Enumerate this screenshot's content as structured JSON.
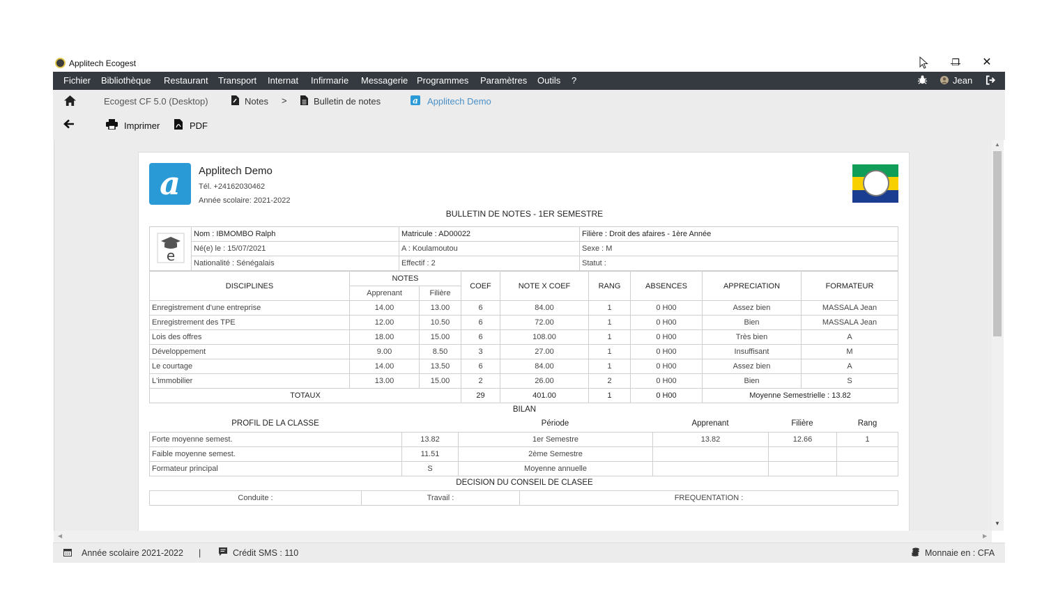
{
  "window": {
    "title": "Applitech Ecogest"
  },
  "menu": {
    "items": [
      "Fichier",
      "Bibliothèque",
      "Restaurant",
      "Transport",
      "Internat",
      "Infirmarie",
      "Messagerie",
      "Programmes",
      "Paramètres",
      "Outils",
      "?"
    ],
    "user": "Jean"
  },
  "breadcrumb": {
    "app": "Ecogest CF 5.0 (Desktop)",
    "notes": "Notes",
    "separator": ">",
    "bulletin": "Bulletin de notes",
    "school": "Applitech Demo"
  },
  "toolbar": {
    "print": "Imprimer",
    "pdf": "PDF"
  },
  "school": {
    "name": "Applitech Demo",
    "phone": "Tél. +24162030462",
    "year": "Année scolaire: 2021-2022",
    "logo_letter": "a"
  },
  "report_title": "BULLETIN DE NOTES - 1ER SEMESTRE",
  "student": {
    "nom": "Nom : IBMOMBO Ralph",
    "matricule": "Matricule : AD00022",
    "filiere": "Filière : Droit des afaires - 1ère Année",
    "naissance": "Né(e) le : 15/07/2021",
    "lieu": "A : Koulamoutou",
    "sexe": "Sexe : M",
    "nationalite": "Nationalité : Sénégalais",
    "effectif": "Effectif : 2",
    "statut": "Statut :"
  },
  "grades": {
    "headers": {
      "disciplines": "DISCIPLINES",
      "notes": "NOTES",
      "apprenant": "Apprenant",
      "filiere": "Filière",
      "coef": "COEF",
      "note_x_coef": "NOTE X COEF",
      "rang": "RANG",
      "absences": "ABSENCES",
      "appreciation": "APPRECIATION",
      "formateur": "FORMATEUR"
    },
    "rows": [
      {
        "discipline": "Enregistrement d'une entreprise",
        "apprenant": "14.00",
        "filiere": "13.00",
        "coef": "6",
        "note_x_coef": "84.00",
        "rang": "1",
        "absences": "0 H00",
        "appreciation": "Assez bien",
        "formateur": "MASSALA Jean"
      },
      {
        "discipline": "Enregistrement des TPE",
        "apprenant": "12.00",
        "filiere": "10.50",
        "coef": "6",
        "note_x_coef": "72.00",
        "rang": "1",
        "absences": "0 H00",
        "appreciation": "Bien",
        "formateur": "MASSALA Jean"
      },
      {
        "discipline": "Lois des offres",
        "apprenant": "18.00",
        "filiere": "15.00",
        "coef": "6",
        "note_x_coef": "108.00",
        "rang": "1",
        "absences": "0 H00",
        "appreciation": "Très bien",
        "formateur": "A"
      },
      {
        "discipline": "Développement",
        "apprenant": "9.00",
        "filiere": "8.50",
        "coef": "3",
        "note_x_coef": "27.00",
        "rang": "1",
        "absences": "0 H00",
        "appreciation": "Insuffisant",
        "formateur": "M"
      },
      {
        "discipline": "Le courtage",
        "apprenant": "14.00",
        "filiere": "13.50",
        "coef": "6",
        "note_x_coef": "84.00",
        "rang": "1",
        "absences": "0 H00",
        "appreciation": "Assez bien",
        "formateur": "A"
      },
      {
        "discipline": "L'immobilier",
        "apprenant": "13.00",
        "filiere": "15.00",
        "coef": "2",
        "note_x_coef": "26.00",
        "rang": "2",
        "absences": "0 H00",
        "appreciation": "Bien",
        "formateur": "S"
      }
    ],
    "totals": {
      "label": "TOTAUX",
      "coef": "29",
      "note_x_coef": "401.00",
      "rang": "1",
      "absences": "0 H00",
      "moyenne": "Moyenne Semestrielle : 13.82"
    }
  },
  "bilan": {
    "title": "BILAN",
    "profil_title": "PROFIL DE LA CLASSE",
    "periode_h": "Période",
    "apprenant_h": "Apprenant",
    "filiere_h": "Filière",
    "rang_h": "Rang",
    "rows": [
      {
        "label": "Forte moyenne semest.",
        "value": "13.82",
        "periode": "1er Semestre",
        "apprenant": "13.82",
        "filiere": "12.66",
        "rang": "1"
      },
      {
        "label": "Faible moyenne semest.",
        "value": "11.51",
        "periode": "2ème Semestre",
        "apprenant": "",
        "filiere": "",
        "rang": ""
      },
      {
        "label": "Formateur principal",
        "value": "S",
        "periode": "Moyenne annuelle",
        "apprenant": "",
        "filiere": "",
        "rang": ""
      }
    ]
  },
  "decision": {
    "title": "DECISION DU CONSEIL DE CLASEE",
    "conduite": "Conduite :",
    "travail": "Travail :",
    "frequentation": "FREQUENTATION :"
  },
  "status": {
    "year": "Année scolaire 2021-2022",
    "separator": "|",
    "sms": "Crédit SMS : 110",
    "currency": "Monnaie en : CFA"
  }
}
